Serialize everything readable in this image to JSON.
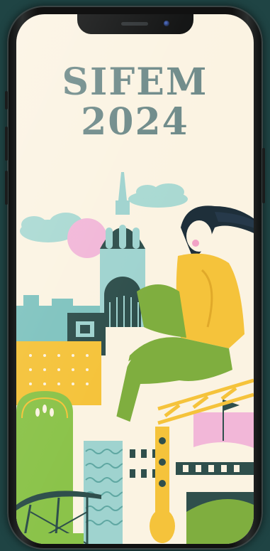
{
  "poster": {
    "title_line1": "SIFEM",
    "title_line2": "2024"
  },
  "colors": {
    "background": "#1f4444",
    "screen_bg": "#fbf3e2",
    "title": "#6e8a89",
    "teal_dark": "#2f4f4c",
    "mint": "#9fd3cf",
    "yellow": "#f5c33b",
    "green": "#7fae3f",
    "pink": "#f2b7d8",
    "hair": "#1e2f3a"
  },
  "icons": {
    "camera": "front-camera-icon",
    "speaker": "earpiece-speaker-icon"
  }
}
